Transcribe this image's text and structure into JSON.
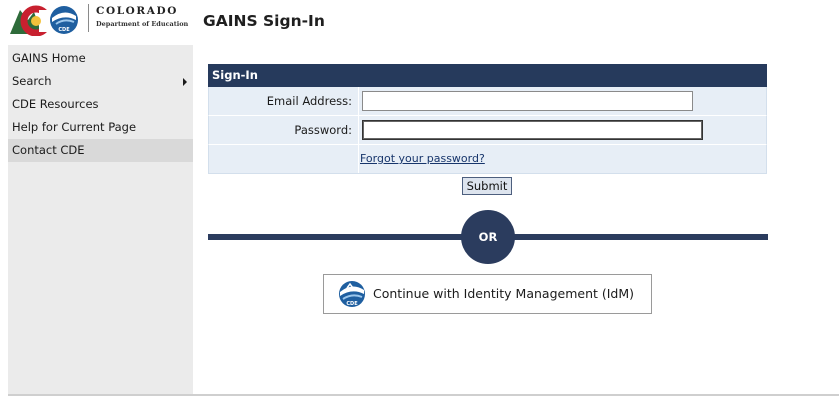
{
  "header": {
    "logo_name": "COLORADO",
    "logo_sub": "Department of Education",
    "logo_badge": "CDE",
    "page_title": "GAINS Sign-In"
  },
  "sidebar": {
    "items": [
      {
        "label": "GAINS Home"
      },
      {
        "label": "Search",
        "has_submenu": true
      },
      {
        "label": "CDE Resources"
      },
      {
        "label": "Help for Current Page"
      },
      {
        "label": "Contact CDE",
        "active": true
      }
    ]
  },
  "signin": {
    "header": "Sign-In",
    "email_label": "Email Address:",
    "email_value": "",
    "password_label": "Password:",
    "password_value": "",
    "forgot_link": "Forgot your password?",
    "submit_label": "Submit"
  },
  "divider": {
    "or_label": "OR"
  },
  "idm": {
    "label": "Continue with Identity Management (IdM)",
    "badge": "CDE"
  },
  "colors": {
    "navy": "#263a5c",
    "row_bg": "#e7eef6",
    "sidebar_bg": "#ebebeb",
    "link": "#17356b"
  },
  "icons": {
    "logo": "colorado-cde-logo",
    "idm": "cde-globe-icon",
    "submenu": "caret-right-icon"
  }
}
